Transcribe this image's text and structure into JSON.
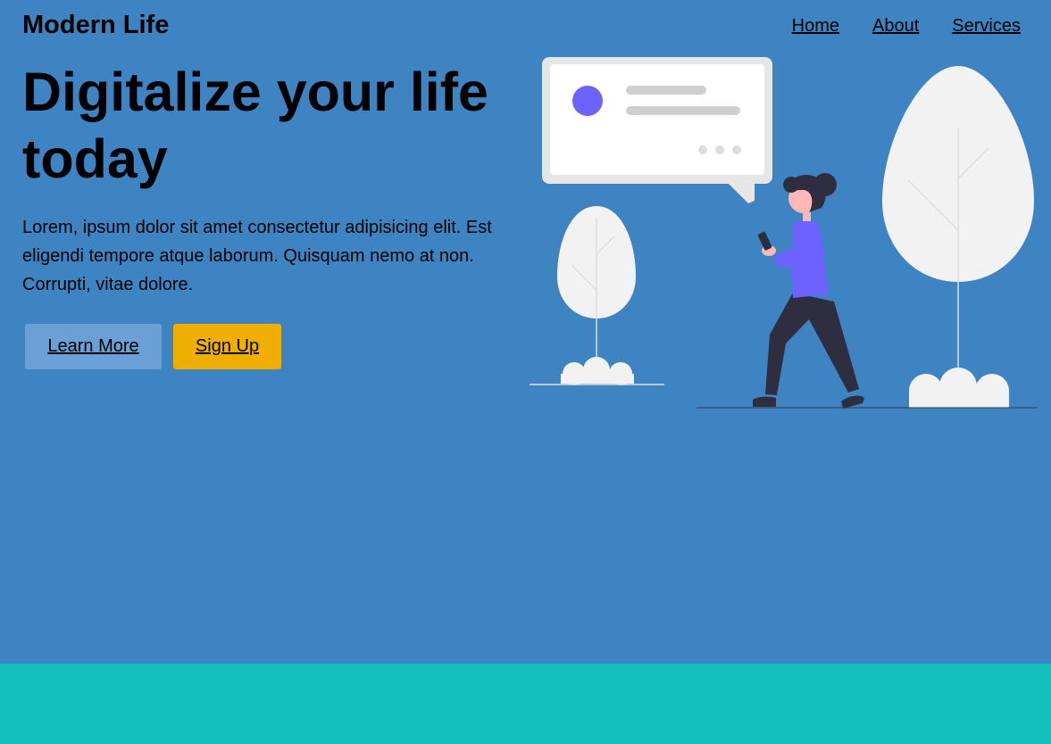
{
  "header": {
    "logo": "Modern Life",
    "nav": [
      {
        "label": "Home"
      },
      {
        "label": "About"
      },
      {
        "label": "Services"
      }
    ]
  },
  "hero": {
    "headline": "Digitalize your life today",
    "lead": "Lorem, ipsum dolor sit amet consectetur adipisicing elit. Est eligendi tempore atque laborum. Quisquam nemo at non. Corrupti, vitae dolore.",
    "buttons": {
      "learn_more": "Learn More",
      "sign_up": "Sign Up"
    }
  },
  "illustration": {
    "icons": [
      "chat-bubble-icon",
      "tree-icon",
      "bush-icon",
      "woman-with-phone-icon"
    ]
  },
  "colors": {
    "hero_bg": "#3e84c2",
    "footer_band": "#14c0bc",
    "learn_more_button": "#6aa0d6",
    "sign_up_button": "#f0ae00",
    "accent_purple": "#6c63ff"
  }
}
